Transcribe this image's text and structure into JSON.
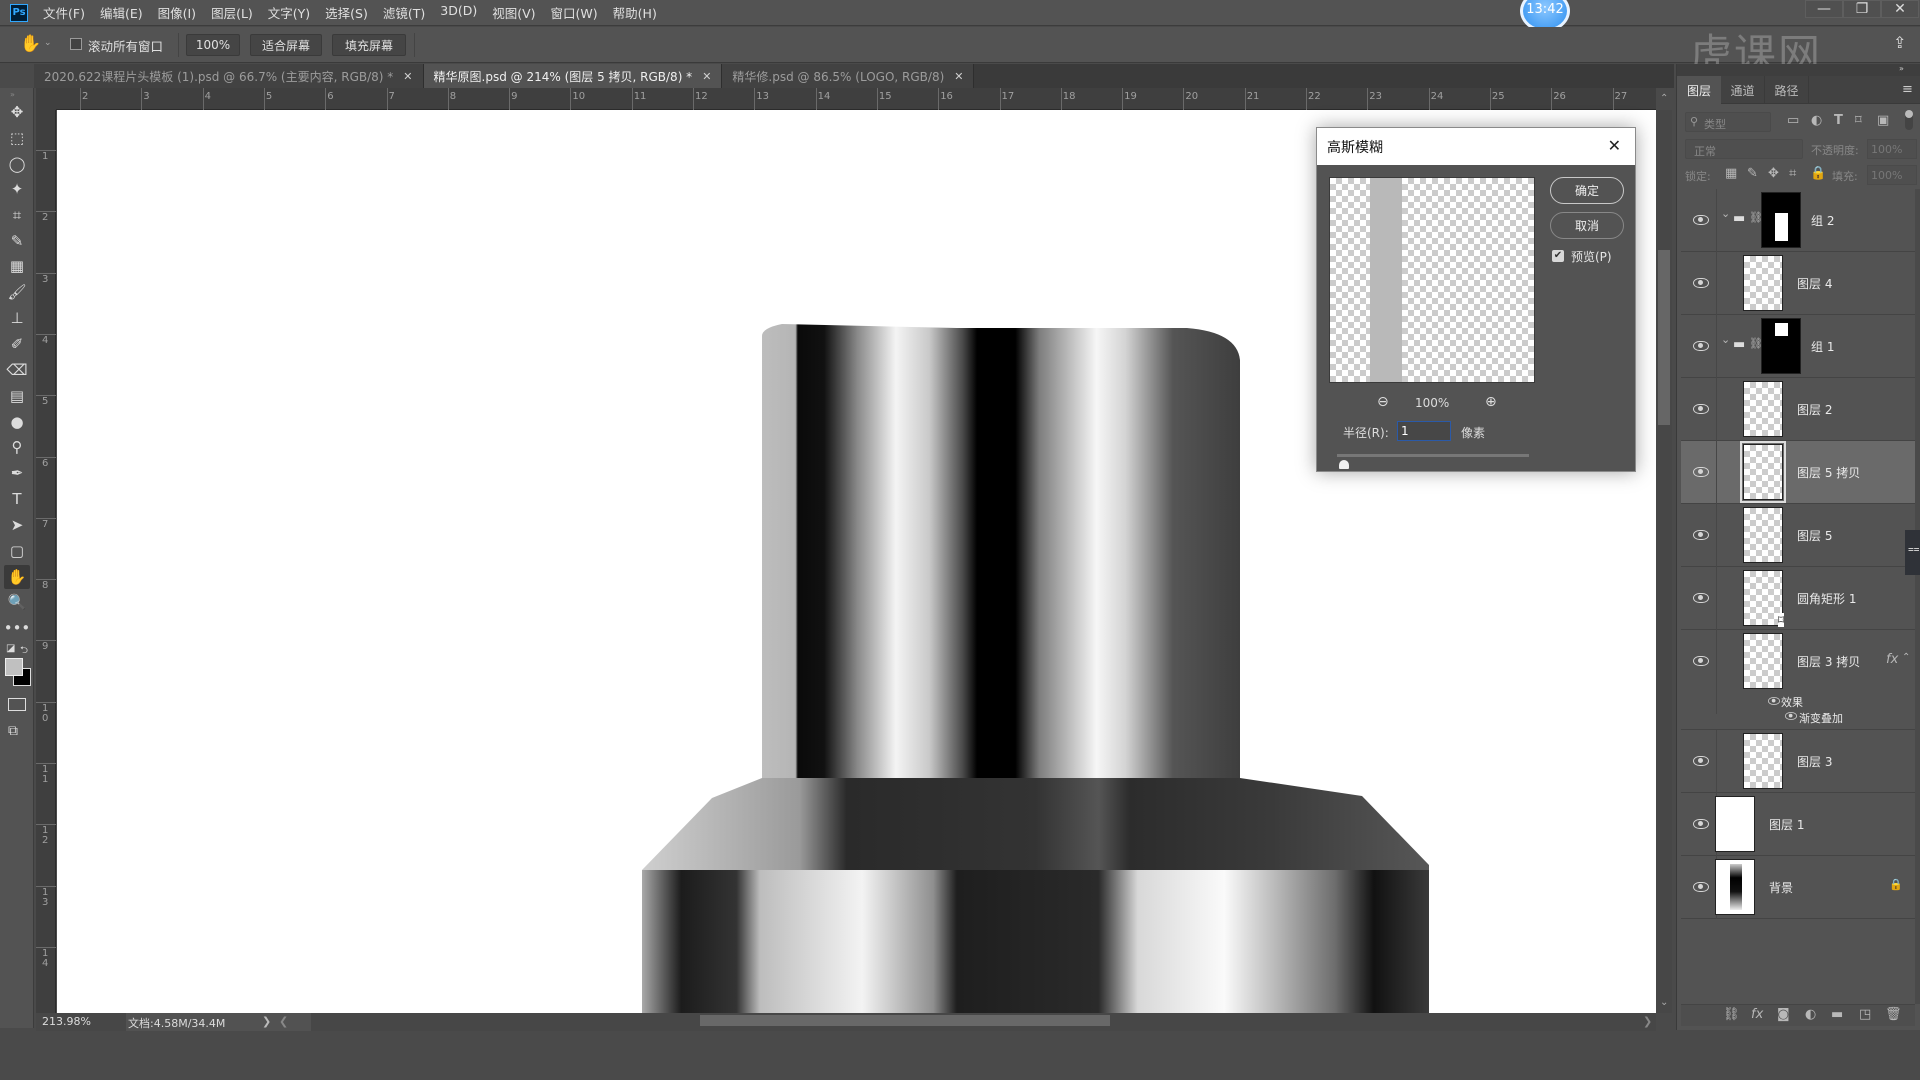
{
  "app": {
    "logo": "Ps",
    "clock": "13:42",
    "watermark": "虎课网"
  },
  "menu": [
    "文件(F)",
    "编辑(E)",
    "图像(I)",
    "图层(L)",
    "文字(Y)",
    "选择(S)",
    "滤镜(T)",
    "3D(D)",
    "视图(V)",
    "窗口(W)",
    "帮助(H)"
  ],
  "window_controls": {
    "minimize": "—",
    "restore": "❐",
    "close": "✕"
  },
  "options": {
    "tool_icon": "hand-icon",
    "scroll_all_label": "滚动所有窗口",
    "scroll_all_checked": false,
    "zoom_100": "100%",
    "fit_screen": "适合屏幕",
    "fill_screen": "填充屏幕"
  },
  "tabs": [
    {
      "label": "2020.622课程片头模板 (1).psd @ 66.7% (主要内容, RGB/8) *",
      "close": "✕",
      "active": false
    },
    {
      "label": "精华原图.psd @ 214% (图层 5 拷贝, RGB/8) *",
      "close": "✕",
      "active": true
    },
    {
      "label": "精华修.psd @ 86.5% (LOGO, RGB/8)",
      "close": "✕",
      "active": false
    }
  ],
  "tools": [
    "move-tool",
    "marquee-tool",
    "lasso-tool",
    "magic-wand-tool",
    "crop-tool",
    "eyedropper-tool",
    "frame-tool",
    "brush-tool",
    "stamp-tool",
    "history-brush-tool",
    "eraser-tool",
    "gradient-tool",
    "blur-tool",
    "dodge-tool",
    "pen-tool",
    "type-tool",
    "path-select-tool",
    "shape-tool",
    "hand-tool",
    "zoom-tool",
    "more-tools"
  ],
  "tool_glyphs": [
    "✥",
    "⬚",
    "◯",
    "✦",
    "⌗",
    "✎",
    "▦",
    "🖌",
    "⊥",
    "✐",
    "⌫",
    "▤",
    "●",
    "⚲",
    "✒",
    "T",
    "➤",
    "▢",
    "✋",
    "🔍",
    "•••"
  ],
  "active_tool": "hand-tool",
  "colors": {
    "foreground": "#c0c0c0",
    "background": "#000000",
    "accent": "#31a8ff"
  },
  "ruler": {
    "h_ticks": [
      "2",
      "3",
      "4",
      "5",
      "6",
      "7",
      "8",
      "9",
      "10",
      "11",
      "12",
      "13",
      "14",
      "15",
      "16",
      "17",
      "18",
      "19",
      "20",
      "21",
      "22",
      "23",
      "24",
      "25",
      "26",
      "27"
    ],
    "v_ticks": [
      "1",
      "2",
      "3",
      "4",
      "5",
      "6",
      "7",
      "8",
      "9",
      "10",
      "11",
      "12",
      "13",
      "14"
    ]
  },
  "status": {
    "zoom": "213.98%",
    "doc": "文档:4.58M/34.4M",
    "arrow": "❯",
    "back": "❮"
  },
  "dialog": {
    "title": "高斯模糊",
    "close": "✕",
    "ok": "确定",
    "cancel": "取消",
    "preview_label": "预览(P)",
    "preview_checked": true,
    "zoom_level": "100%",
    "radius_label": "半径(R):",
    "radius_value": "1",
    "radius_unit": "像素",
    "radius_slider_fraction": 0.01
  },
  "layers_panel": {
    "tabs": [
      "图层",
      "通道",
      "路径"
    ],
    "active_tab": "图层",
    "filter_placeholder": "类型",
    "blend_mode": "正常",
    "opacity_label": "不透明度:",
    "opacity_value": "100%",
    "lock_label": "锁定:",
    "fill_label": "填充:",
    "fill_value": "100%",
    "layers": [
      {
        "name": "组 2",
        "type": "group",
        "visible": true,
        "expanded": true,
        "selected": false
      },
      {
        "name": "图层 4",
        "type": "layer",
        "visible": true,
        "selected": false
      },
      {
        "name": "组 1",
        "type": "group",
        "visible": true,
        "expanded": true,
        "selected": false
      },
      {
        "name": "图层 2",
        "type": "layer",
        "visible": true,
        "selected": false
      },
      {
        "name": "图层 5 拷贝",
        "type": "layer",
        "visible": true,
        "selected": true
      },
      {
        "name": "图层 5",
        "type": "layer",
        "visible": true,
        "selected": false
      },
      {
        "name": "圆角矩形 1",
        "type": "shape",
        "visible": true,
        "selected": false
      },
      {
        "name": "图层 3 拷贝",
        "type": "layer",
        "visible": true,
        "selected": false,
        "fx": "fx",
        "effects_label": "效果",
        "effects": [
          "渐变叠加"
        ]
      },
      {
        "name": "图层 3",
        "type": "layer",
        "visible": true,
        "selected": false
      },
      {
        "name": "图层 1",
        "type": "layer",
        "visible": true,
        "selected": false
      },
      {
        "name": "背景",
        "type": "background",
        "visible": true,
        "selected": false,
        "locked": true
      }
    ],
    "footer_icons": [
      "link-icon",
      "fx-icon",
      "mask-icon",
      "adjustment-icon",
      "folder-icon",
      "new-layer-icon",
      "trash-icon"
    ]
  }
}
